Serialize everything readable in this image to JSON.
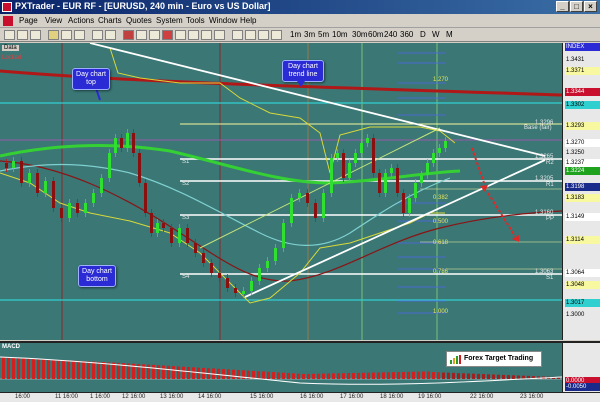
{
  "window": {
    "title": "PXTrader - EUR RF - [EURUSD, 240 min - Euro vs US Dollar]",
    "min_glyph": "_",
    "max_glyph": "□",
    "close_glyph": "×"
  },
  "menu": {
    "items": [
      "Page",
      "View",
      "Actions",
      "Charts",
      "Quotes",
      "System",
      "Tools",
      "Window",
      "Help"
    ]
  },
  "toolbar": {
    "timeframes": [
      "1m",
      "3m",
      "5m",
      "10m",
      "30m",
      "60m",
      "240",
      "360",
      "D",
      "W",
      "M"
    ]
  },
  "chart": {
    "data_tab": "Data",
    "locked_tag": "Locked",
    "index_tag": "INDEX",
    "background_color": "#3a7775",
    "callouts": {
      "day_top": [
        "Day chart",
        "top"
      ],
      "trend_line": [
        "Day chart",
        "trend line"
      ],
      "day_bottom": [
        "Day chart",
        "bottom"
      ]
    },
    "base_label": "Base (fair)",
    "fib_labels": [
      "0.000",
      "0.382",
      "0.500",
      "0.618",
      "0.786",
      "1.000"
    ],
    "fib_top_label": "1.270",
    "pivot_labels": [
      "S1",
      "S2",
      "S3",
      "S4"
    ],
    "level_tags": [
      "1.3296",
      "1.3265",
      "1.3205",
      "1.3160",
      "1.3063"
    ],
    "pivot_right_tags": [
      "R2",
      "R1",
      "PP",
      "S1"
    ],
    "brand": "Forex Target Trading"
  },
  "price_axis": {
    "labels": [
      {
        "text": "INDEX",
        "color": "#2b2bd6",
        "fg": "#fff"
      },
      {
        "text": "1.3431",
        "color": "#e8e8e8",
        "fg": "#000"
      },
      {
        "text": "1.3371",
        "color": "#f8f8a0",
        "fg": "#000"
      },
      {
        "text": "1.3344",
        "color": "#c8102e",
        "fg": "#fff"
      },
      {
        "text": "1.3302",
        "color": "#30d0d0",
        "fg": "#000"
      },
      {
        "text": "1.3293",
        "color": "#f8f8a0",
        "fg": "#000"
      },
      {
        "text": "1.3270",
        "color": "#ffffff",
        "fg": "#000"
      },
      {
        "text": "1.3250",
        "color": "#e8e8e8",
        "fg": "#000"
      },
      {
        "text": "1.3237",
        "color": "#ffffff",
        "fg": "#000"
      },
      {
        "text": "1.3224",
        "color": "#1fa31f",
        "fg": "#fff"
      },
      {
        "text": "1.3198",
        "color": "#1a2a8a",
        "fg": "#fff"
      },
      {
        "text": "1.3183",
        "color": "#f8f8a0",
        "fg": "#000"
      },
      {
        "text": "1.3149",
        "color": "#ffffff",
        "fg": "#000"
      },
      {
        "text": "1.3114",
        "color": "#f8f8a0",
        "fg": "#000"
      },
      {
        "text": "1.3064",
        "color": "#ffffff",
        "fg": "#000"
      },
      {
        "text": "1.3048",
        "color": "#f8f8a0",
        "fg": "#000"
      },
      {
        "text": "1.3017",
        "color": "#30d0d0",
        "fg": "#000"
      },
      {
        "text": "1.3000",
        "color": "#e8e8e8",
        "fg": "#000"
      }
    ]
  },
  "macd": {
    "title": "MACD",
    "axis_labels": [
      "0.0000",
      "-0.0050"
    ]
  },
  "time_axis": {
    "labels": [
      "16:00",
      "11 16:00",
      "1 16:00",
      "12 16:00",
      "13 16:00",
      "14 16:00",
      "15 16:00",
      "16 16:00",
      "17 16:00",
      "18 16:00",
      "19 16:00",
      "22 16:00",
      "23 16:00"
    ]
  }
}
